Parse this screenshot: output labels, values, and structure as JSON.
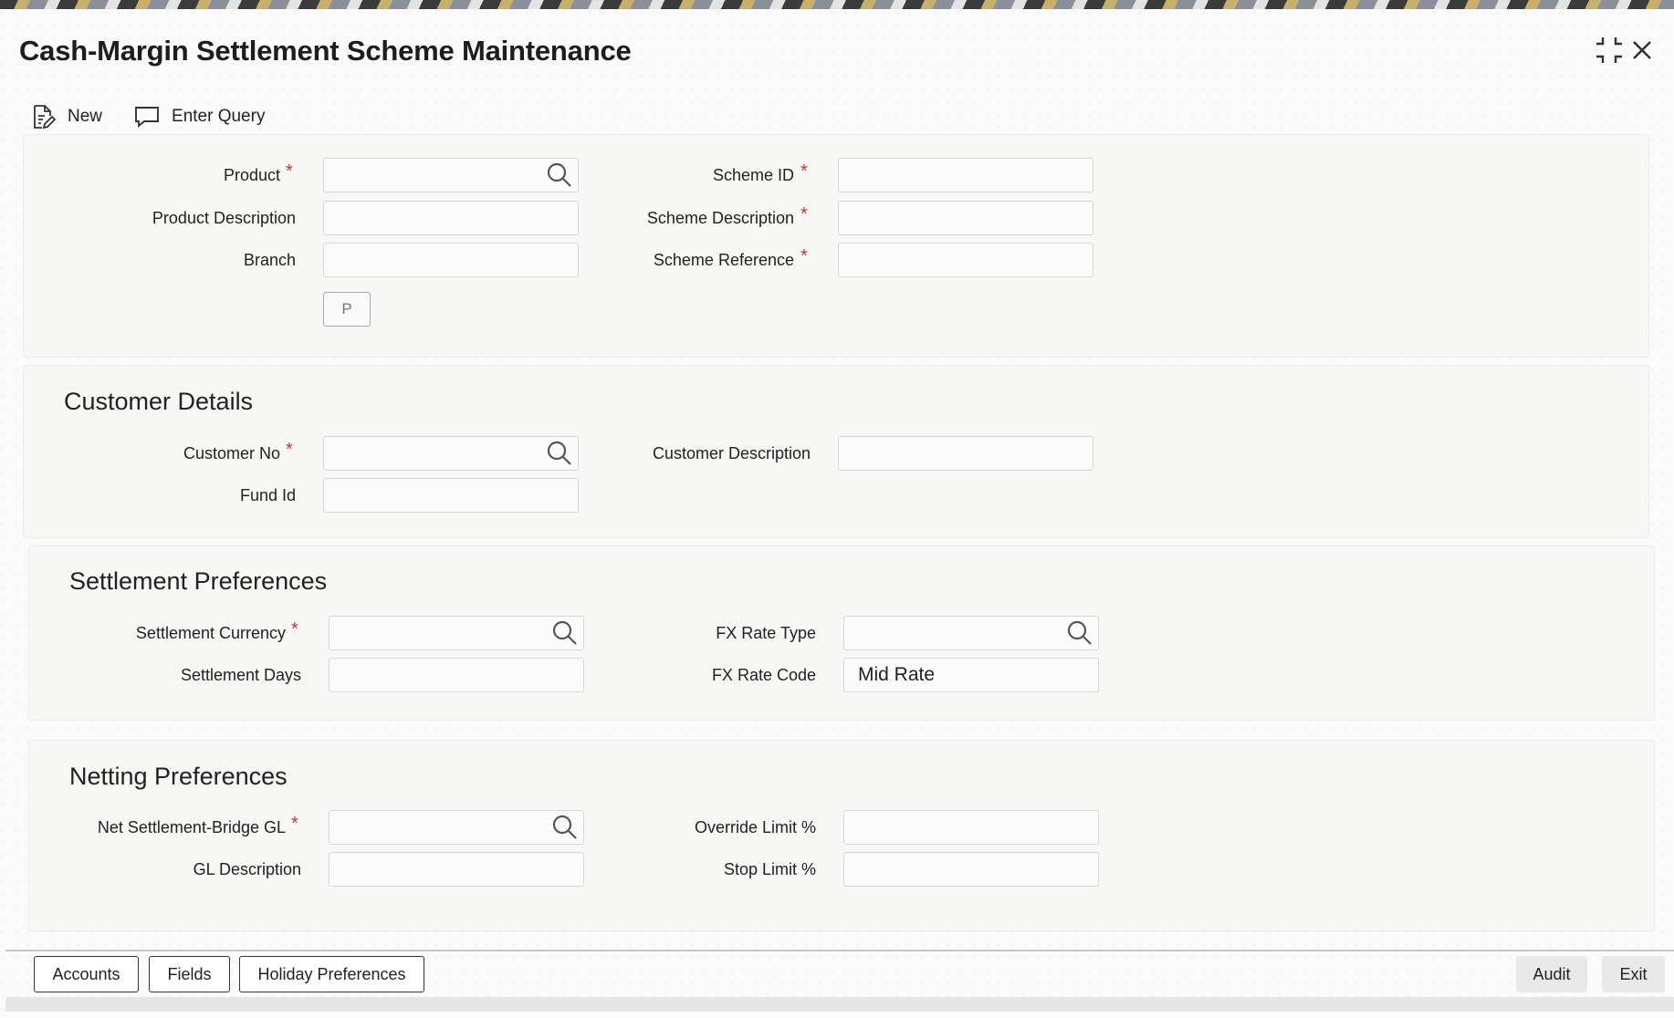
{
  "window": {
    "title": "Cash-Margin Settlement Scheme Maintenance",
    "controls": {
      "restore_icon": "restore-icon",
      "close_icon": "close-icon"
    }
  },
  "toolbar": {
    "new_label": "New",
    "enter_query_label": "Enter Query"
  },
  "header_section": {
    "product_label": "Product",
    "product_value": "",
    "product_description_label": "Product Description",
    "product_description_value": "",
    "branch_label": "Branch",
    "branch_value": "",
    "p_button_label": "P",
    "scheme_id_label": "Scheme ID",
    "scheme_id_value": "",
    "scheme_description_label": "Scheme Description",
    "scheme_description_value": "",
    "scheme_reference_label": "Scheme Reference",
    "scheme_reference_value": ""
  },
  "customer_details": {
    "title": "Customer Details",
    "customer_no_label": "Customer No",
    "customer_no_value": "",
    "fund_id_label": "Fund Id",
    "fund_id_value": "",
    "customer_description_label": "Customer Description",
    "customer_description_value": ""
  },
  "settlement_preferences": {
    "title": "Settlement Preferences",
    "settlement_currency_label": "Settlement Currency",
    "settlement_currency_value": "",
    "settlement_days_label": "Settlement Days",
    "settlement_days_value": "",
    "fx_rate_type_label": "FX Rate Type",
    "fx_rate_type_value": "",
    "fx_rate_code_label": "FX Rate Code",
    "fx_rate_code_value": "Mid Rate"
  },
  "netting_preferences": {
    "title": "Netting Preferences",
    "net_settlement_bridge_gl_label": "Net Settlement-Bridge GL",
    "net_settlement_bridge_gl_value": "",
    "gl_description_label": "GL Description",
    "gl_description_value": "",
    "override_limit_label": "Override Limit %",
    "override_limit_value": "",
    "stop_limit_label": "Stop Limit %",
    "stop_limit_value": ""
  },
  "required_marker": "*",
  "footer": {
    "accounts_label": "Accounts",
    "fields_label": "Fields",
    "holiday_preferences_label": "Holiday Preferences",
    "audit_label": "Audit",
    "exit_label": "Exit"
  },
  "colors": {
    "required": "#c0392b",
    "panel_background": "#f7f7f6",
    "field_border": "#d6d6d6"
  }
}
